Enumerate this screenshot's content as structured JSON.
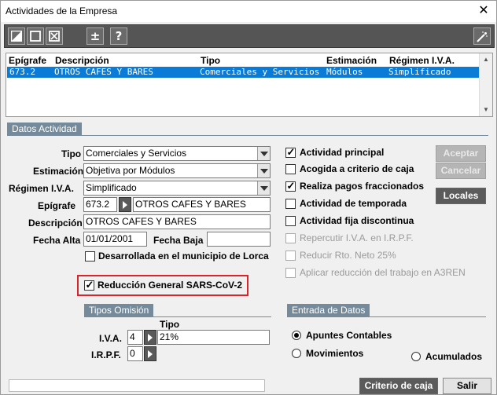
{
  "window": {
    "title": "Actividades de la Empresa",
    "close": "✕"
  },
  "toolbar": {
    "new_icon": "new-record-icon",
    "edit_icon": "blank-record-icon",
    "delete_icon": "delete-record-icon",
    "toggle_label": "±",
    "help_label": "?",
    "wand_icon": "magic-wand-icon"
  },
  "grid": {
    "headers": [
      "Epígrafe",
      "Descripción",
      "Tipo",
      "Estimación",
      "Régimen I.V.A."
    ],
    "rows": [
      [
        "673.2",
        "OTROS CAFES Y BARES",
        "Comerciales y Servicios",
        "Módulos",
        "Simplificado"
      ]
    ]
  },
  "datos": {
    "tab_label": "Datos Actividad",
    "tipo_label": "Tipo",
    "tipo_value": "Comerciales y Servicios",
    "estimacion_label": "Estimación",
    "estimacion_value": "Objetiva por Módulos",
    "regimen_label": "Régimen I.V.A.",
    "regimen_value": "Simplificado",
    "epigrafe_label": "Epígrafe",
    "epigrafe_value": "673.2",
    "epigrafe_desc": "OTROS CAFES Y BARES",
    "descripcion_label": "Descripción",
    "descripcion_value": "OTROS CAFES Y BARES",
    "fecha_alta_label": "Fecha Alta",
    "fecha_alta_value": "01/01/2001",
    "fecha_baja_label": "Fecha Baja",
    "fecha_baja_value": "",
    "lorca_label": "Desarrollada en el municipio de Lorca",
    "sars_label": "Reducción General SARS-CoV-2"
  },
  "checks": [
    {
      "label": "Actividad principal",
      "checked": true,
      "disabled": false
    },
    {
      "label": "Acogida a criterio de caja",
      "checked": false,
      "disabled": false
    },
    {
      "label": "Realiza pagos fraccionados",
      "checked": true,
      "disabled": false
    },
    {
      "label": "Actividad de temporada",
      "checked": false,
      "disabled": false
    },
    {
      "label": "Actividad fija discontinua",
      "checked": false,
      "disabled": false
    },
    {
      "label": "Repercutir I.V.A. en I.R.P.F.",
      "checked": false,
      "disabled": true
    },
    {
      "label": "Reducir Rto. Neto 25%",
      "checked": false,
      "disabled": true
    },
    {
      "label": "Aplicar reducción del trabajo en A3REN",
      "checked": false,
      "disabled": true
    }
  ],
  "buttons": {
    "aceptar": "Aceptar",
    "cancelar": "Cancelar",
    "locales": "Locales",
    "criterio": "Criterio de caja",
    "salir": "Salir"
  },
  "omision": {
    "tab_label": "Tipos Omisión",
    "tipo_header": "Tipo",
    "iva_label": "I.V.A.",
    "iva_code": "4",
    "iva_value": "21%",
    "irpf_label": "I.R.P.F.",
    "irpf_code": "0",
    "irpf_value": ""
  },
  "entrada": {
    "tab_label": "Entrada de Datos",
    "options": [
      {
        "label": "Apuntes Contables",
        "selected": true
      },
      {
        "label": "Movimientos",
        "selected": false
      },
      {
        "label": "Acumulados",
        "selected": false
      }
    ]
  },
  "status": {
    "text": ""
  }
}
